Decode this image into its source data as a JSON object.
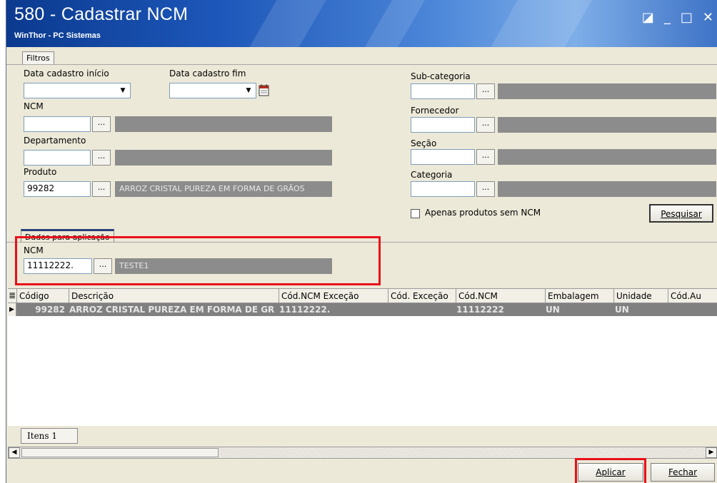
{
  "window": {
    "title": "580 - Cadastrar  NCM",
    "subtitle": "WinThor - PC Sistemas",
    "controls": [
      "◪",
      "_",
      "□",
      "✕"
    ]
  },
  "tabs": {
    "filtros": "Filtros",
    "dados": "Dados para aplicação"
  },
  "filters": {
    "data_inicio_label": "Data cadastro início",
    "data_inicio_value": "",
    "data_fim_label": "Data cadastro fim",
    "data_fim_value": "",
    "ncm_label": "NCM",
    "ncm_value": "",
    "ncm_desc": "",
    "departamento_label": "Departamento",
    "departamento_value": "",
    "departamento_desc": "",
    "produto_label": "Produto",
    "produto_value": "99282",
    "produto_desc": "ARROZ  CRISTAL PUREZA EM FORMA DE GRÃOS",
    "subcategoria_label": "Sub-categoria",
    "fornecedor_label": "Fornecedor",
    "secao_label": "Seção",
    "categoria_label": "Categoria",
    "apenas_label": "Apenas produtos sem NCM",
    "apenas_checked": false,
    "pesquisar_label": "Pesquisar",
    "lookup_label": "..."
  },
  "aplicacao": {
    "ncm_label": "NCM",
    "ncm_value": "11112222.",
    "ncm_desc": "TESTE1"
  },
  "grid": {
    "columns": [
      "Código",
      "Descrição",
      "Cód.NCM Exceção",
      "Cód. Exceção",
      "Cód.NCM",
      "Embalagem",
      "Unidade",
      "Cód.Au"
    ],
    "rows": [
      {
        "codigo": "99282",
        "descricao": "ARROZ  CRISTAL PUREZA EM FORMA DE GR",
        "ncm_excecao": "11112222.",
        "cod_excecao": "",
        "ncm": "11112222",
        "embalagem": "UN",
        "unidade": "UN"
      }
    ]
  },
  "status": {
    "items": "Itens 1"
  },
  "buttons": {
    "aplicar": "Aplicar",
    "fechar": "Fechar"
  },
  "colors": {
    "highlight": "#e8101a",
    "row_selected": "#808080",
    "title_gradient_start": "#0b3a8f"
  }
}
